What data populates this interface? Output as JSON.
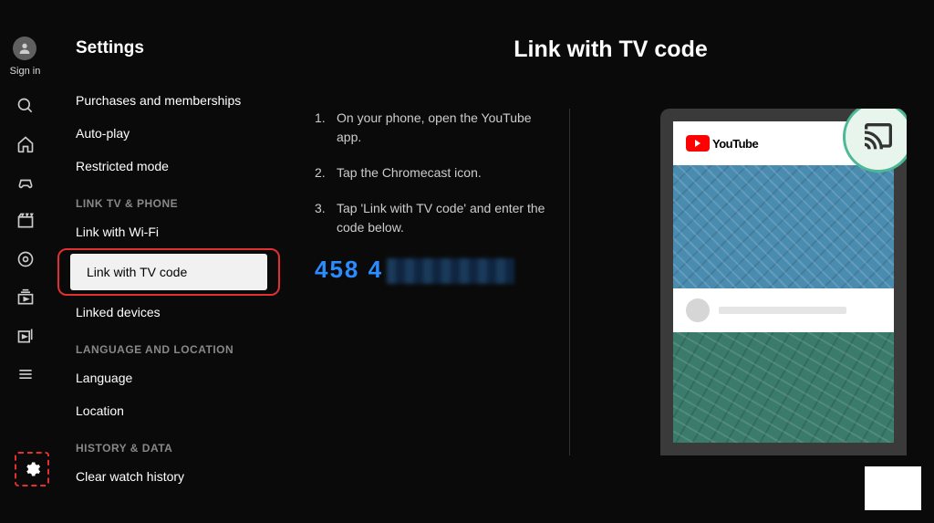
{
  "user": {
    "signin_label": "Sign in"
  },
  "page_title": "Settings",
  "menu": {
    "purchases": "Purchases and memberships",
    "autoplay": "Auto-play",
    "restricted": "Restricted mode",
    "header_link": "LINK TV & PHONE",
    "link_wifi": "Link with Wi-Fi",
    "link_tvcode": "Link with TV code",
    "linked_devices": "Linked devices",
    "header_lang": "LANGUAGE AND LOCATION",
    "language": "Language",
    "location": "Location",
    "header_history": "HISTORY & DATA",
    "clear_history": "Clear watch history"
  },
  "main": {
    "title": "Link with TV code",
    "steps": {
      "s1": "On your phone, open the YouTube app.",
      "s2": "Tap the Chromecast icon.",
      "s3": "Tap 'Link with TV code' and enter the code below."
    },
    "code_visible": "458 4",
    "yt_brand": "YouTube"
  }
}
